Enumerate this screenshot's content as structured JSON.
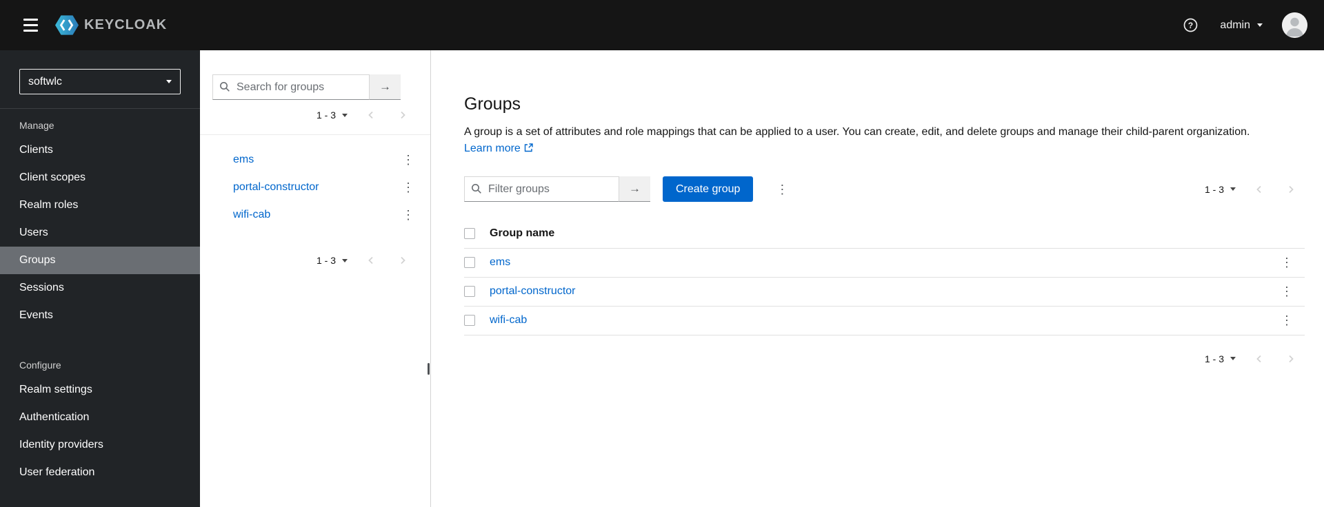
{
  "header": {
    "brand": "KEYCLOAK",
    "user_menu": "admin"
  },
  "sidebar": {
    "realm_selector": "softwlc",
    "sections": [
      {
        "title": "Manage",
        "items": [
          {
            "label": "Clients"
          },
          {
            "label": "Client scopes"
          },
          {
            "label": "Realm roles"
          },
          {
            "label": "Users"
          },
          {
            "label": "Groups",
            "active": true
          },
          {
            "label": "Sessions"
          },
          {
            "label": "Events"
          }
        ]
      },
      {
        "title": "Configure",
        "items": [
          {
            "label": "Realm settings"
          },
          {
            "label": "Authentication"
          },
          {
            "label": "Identity providers"
          },
          {
            "label": "User federation"
          }
        ]
      }
    ]
  },
  "tree_panel": {
    "search_placeholder": "Search for groups",
    "pagination_range": "1 - 3",
    "groups": [
      {
        "name": "ems"
      },
      {
        "name": "portal-constructor"
      },
      {
        "name": "wifi-cab"
      }
    ]
  },
  "main": {
    "title": "Groups",
    "description": "A group is a set of attributes and role mappings that can be applied to a user. You can create, edit, and delete groups and manage their child-parent organization.",
    "learn_more_label": "Learn more",
    "toolbar": {
      "filter_placeholder": "Filter groups",
      "create_button_label": "Create group",
      "pagination_range": "1 - 3"
    },
    "table": {
      "name_header": "Group name",
      "rows": [
        {
          "name": "ems"
        },
        {
          "name": "portal-constructor"
        },
        {
          "name": "wifi-cab"
        }
      ]
    },
    "footer_pagination_range": "1 - 3"
  },
  "icons": {
    "kebab": "⋮",
    "arrow_right": "→"
  },
  "colors": {
    "primary_blue": "#0066cc",
    "link_blue": "#0066cc",
    "masthead_bg": "#151515",
    "sidebar_bg": "#212427",
    "active_nav_bg": "#6a6e73",
    "logo_cyan": "#3cb9d8",
    "logo_blue": "#2a7ab8"
  }
}
